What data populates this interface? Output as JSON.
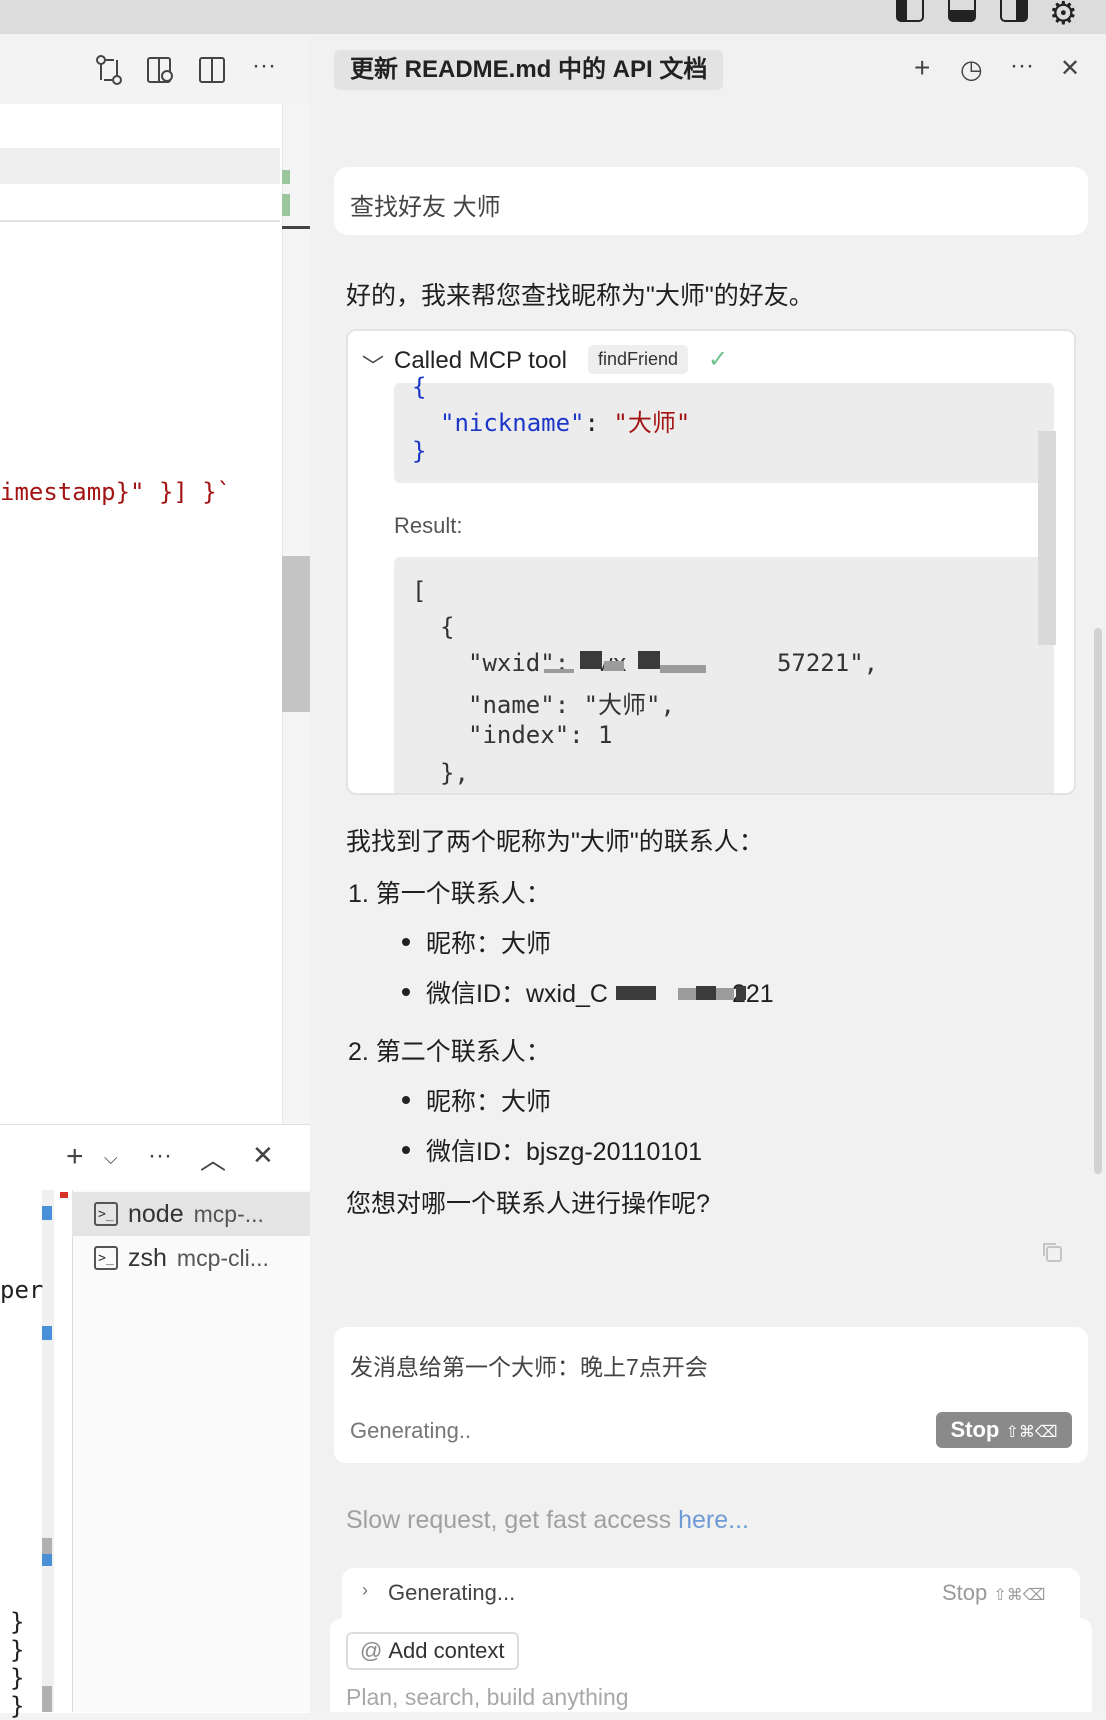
{
  "window": {
    "layout_icons": [
      "panel-left-icon",
      "panel-bottom-icon",
      "panel-right-icon",
      "gear-icon"
    ]
  },
  "editor": {
    "code_fragment": "imestamp}\" }] }`",
    "side_fragment": "per",
    "brace_fragments": [
      "}",
      "}",
      "}",
      "}"
    ]
  },
  "terminal": {
    "items": [
      {
        "name": "node",
        "sub": "mcp-..."
      },
      {
        "name": "zsh",
        "sub": "mcp-cli..."
      }
    ]
  },
  "chat": {
    "title": "更新 README.md 中的 API 文档",
    "user_message": "查找好友 大师",
    "assistant_intro": "好的，我来帮您查找昵称为\"大师\"的好友。",
    "tool_call": {
      "label": "Called MCP tool",
      "tool_name": "findFriend",
      "args_lines": {
        "open": "{",
        "key": "\"nickname\"",
        "colon": ": ",
        "value": "\"大师\"",
        "close": "}"
      },
      "result_label": "Result:",
      "result_lines": {
        "l1": "[",
        "l2": "{",
        "wxid_prefix": "\"wxid\": \"wx",
        "wxid_suffix": "57221\",",
        "name_line": "\"name\": \"大师\",",
        "index_line": "\"index\": 1",
        "close_obj": "},"
      }
    },
    "summary": "我找到了两个昵称为\"大师\"的联系人：",
    "contacts": [
      {
        "heading": "1. 第一个联系人：",
        "nickname": "昵称：大师",
        "wxid_prefix": "微信ID：wxid_C",
        "wxid_suffix": "221"
      },
      {
        "heading": "2. 第二个联系人：",
        "nickname": "昵称：大师",
        "wxid": "微信ID：bjszg-20110101"
      }
    ],
    "question": "您想对哪一个联系人进行操作呢?",
    "input_text": "发消息给第一个大师：晚上7点开会",
    "generating_short": "Generating..",
    "stop_label": "Stop",
    "stop_shortcut": "⇧⌘⌫",
    "slow_text": "Slow request, get fast access ",
    "slow_link": "here...",
    "generating_long": "Generating...",
    "stop2_label": "Stop",
    "stop2_shortcut": "⇧⌘⌫",
    "add_context": "Add context",
    "placeholder": "Plan, search, build anything"
  },
  "colors": {
    "json_key": "#1c37c8",
    "json_string": "#a31515",
    "link": "#6f9bd6",
    "check": "#6cc38c"
  }
}
